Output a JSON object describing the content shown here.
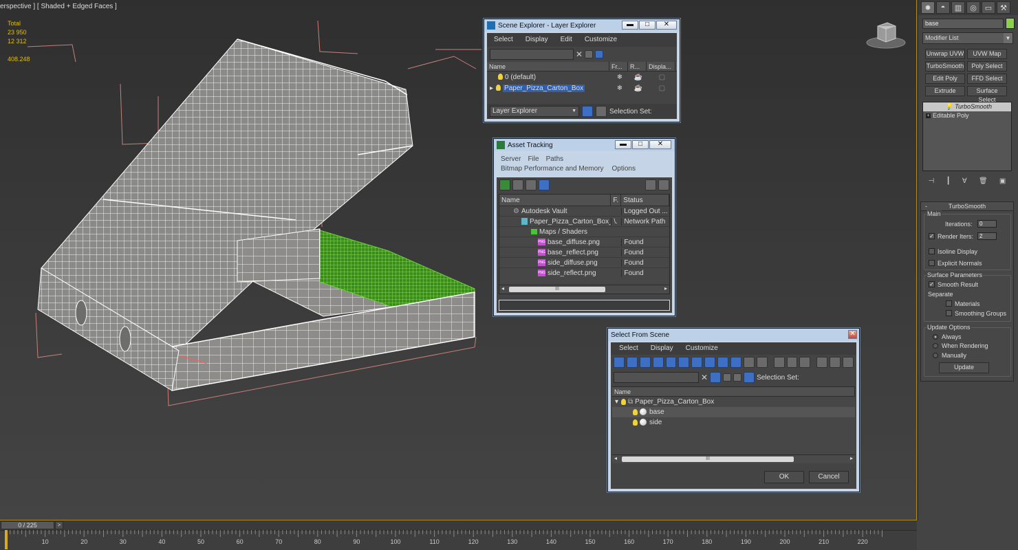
{
  "viewport": {
    "label": "erspective ] [ Shaded + Edged Faces ]",
    "stats": {
      "total_label": "Total",
      "polys": "23 950",
      "verts": "12 312",
      "fps": "408.248"
    }
  },
  "command_panel": {
    "object_name": "base",
    "object_color": "#8bd24a",
    "modifier_list": "Modifier List",
    "buttons": [
      "Unwrap UVW",
      "UVW Map",
      "TurboSmooth",
      "Poly Select",
      "Edit Poly",
      "FFD Select",
      "Extrude",
      "Surface Select"
    ],
    "stack": [
      "TurboSmooth",
      "Editable Poly"
    ],
    "rollout": {
      "title": "TurboSmooth",
      "main": "Main",
      "iterations_label": "Iterations:",
      "iterations": "0",
      "render_iters_label": "Render Iters:",
      "render_iters": "2",
      "isoline": "Isoline Display",
      "explicit": "Explicit Normals",
      "surface_params": "Surface Parameters",
      "smooth_result": "Smooth Result",
      "separate": "Separate",
      "materials": "Materials",
      "smoothing_groups": "Smoothing Groups",
      "update_options": "Update Options",
      "always": "Always",
      "when_rendering": "When Rendering",
      "manually": "Manually",
      "update": "Update"
    }
  },
  "scene_explorer": {
    "title": "Scene Explorer - Layer Explorer",
    "menu": [
      "Select",
      "Display",
      "Edit",
      "Customize"
    ],
    "columns": [
      "Name",
      "Fr...",
      "R...",
      "Displa..."
    ],
    "rows": [
      "0 (default)",
      "Paper_Pizza_Carton_Box"
    ],
    "footer_dropdown": "Layer Explorer",
    "footer_selection": "Selection Set:"
  },
  "asset_tracking": {
    "title": "Asset Tracking",
    "menu1": [
      "Server",
      "File",
      "Paths"
    ],
    "menu2": [
      "Bitmap Performance and Memory",
      "Options"
    ],
    "columns": [
      "Name",
      "F.",
      "Status"
    ],
    "rows": [
      {
        "name": "Autodesk Vault",
        "f": "",
        "status": "Logged Out ..."
      },
      {
        "name": "Paper_Pizza_Carton_Box_...",
        "f": "\\.",
        "status": "Network Path"
      },
      {
        "name": "Maps / Shaders",
        "f": "",
        "status": ""
      },
      {
        "name": "base_diffuse.png",
        "f": "",
        "status": "Found"
      },
      {
        "name": "base_reflect.png",
        "f": "",
        "status": "Found"
      },
      {
        "name": "side_diffuse.png",
        "f": "",
        "status": "Found"
      },
      {
        "name": "side_reflect.png",
        "f": "",
        "status": "Found"
      }
    ],
    "scroll_grip": "III"
  },
  "select_from_scene": {
    "title": "Select From Scene",
    "menu": [
      "Select",
      "Display",
      "Customize"
    ],
    "selection_set": "Selection Set:",
    "column": "Name",
    "rows": [
      "Paper_Pizza_Carton_Box",
      "base",
      "side"
    ],
    "ok": "OK",
    "cancel": "Cancel",
    "scroll_grip": "III"
  },
  "timeline": {
    "frame": "0 / 225",
    "next": ">",
    "ticks": [
      "10",
      "20",
      "30",
      "40",
      "50",
      "60",
      "70",
      "80",
      "90",
      "100",
      "110",
      "120",
      "130",
      "140",
      "150",
      "160",
      "170",
      "180",
      "190",
      "200",
      "210",
      "220"
    ]
  }
}
